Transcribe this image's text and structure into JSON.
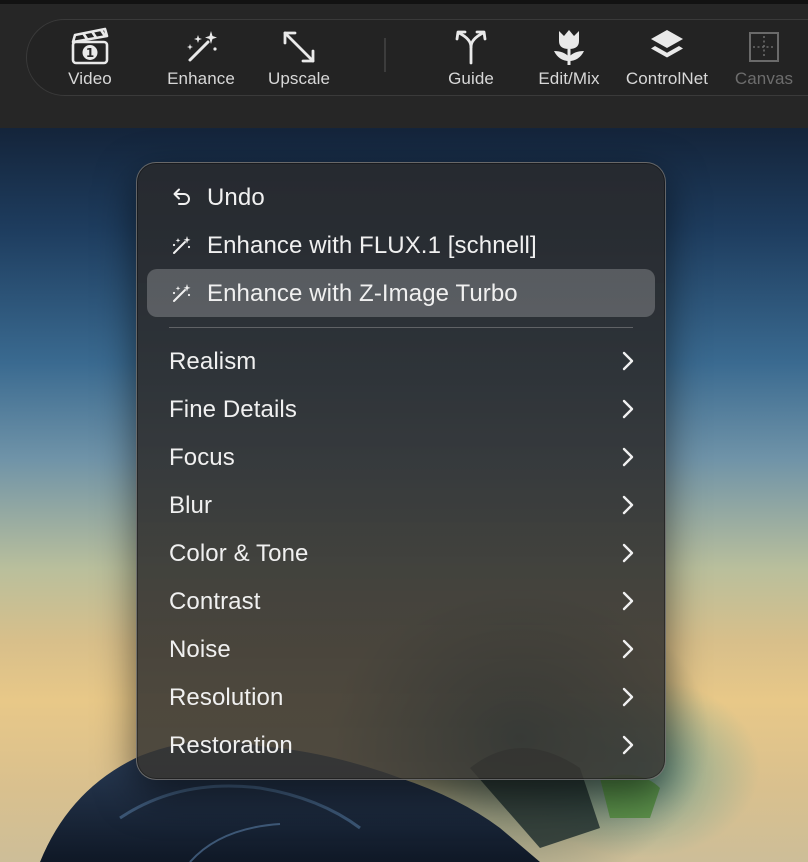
{
  "toolbar": {
    "items": [
      {
        "label": "Video",
        "icon": "clapperboard-icon"
      },
      {
        "label": "Enhance",
        "icon": "magic-wand-icon"
      },
      {
        "label": "Upscale",
        "icon": "expand-arrows-icon"
      },
      {
        "label": "Guide",
        "icon": "fork-icon"
      },
      {
        "label": "Edit/Mix",
        "icon": "tulip-icon"
      },
      {
        "label": "ControlNet",
        "icon": "layers-icon"
      },
      {
        "label": "Canvas",
        "icon": "canvas-grid-icon",
        "disabled": true
      }
    ]
  },
  "menu": {
    "actions": [
      {
        "label": "Undo",
        "icon": "undo-icon"
      },
      {
        "label": "Enhance with FLUX.1 [schnell]",
        "icon": "magic-wand-icon"
      },
      {
        "label": "Enhance with Z-Image Turbo",
        "icon": "magic-wand-icon",
        "highlighted": true
      }
    ],
    "submenus": [
      {
        "label": "Realism"
      },
      {
        "label": "Fine Details"
      },
      {
        "label": "Focus"
      },
      {
        "label": "Blur"
      },
      {
        "label": "Color & Tone"
      },
      {
        "label": "Contrast"
      },
      {
        "label": "Noise"
      },
      {
        "label": "Resolution"
      },
      {
        "label": "Restoration"
      }
    ]
  },
  "colors": {
    "toolbar_bg": "#262626",
    "menu_highlight": "#5a5a5a",
    "text": "#f0f0f0",
    "disabled_text": "#6d6d6d"
  }
}
